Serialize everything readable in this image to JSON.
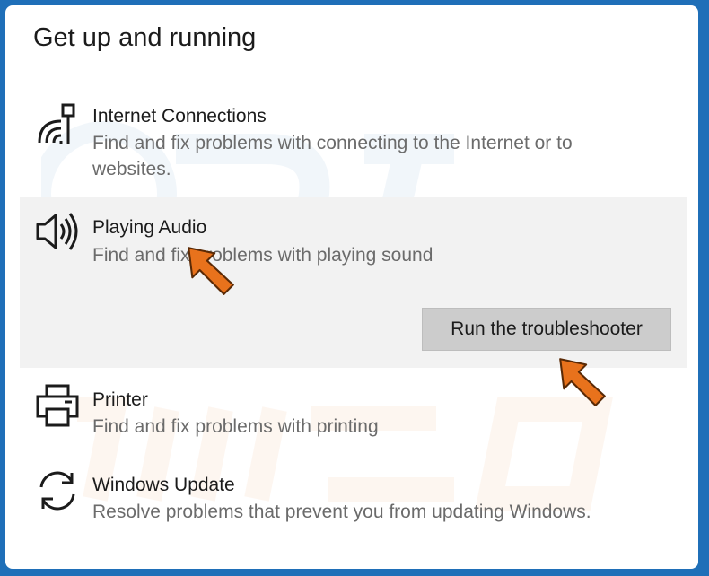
{
  "section_title": "Get up and running",
  "items": [
    {
      "name": "Internet Connections",
      "description": "Find and fix problems with connecting to the Internet or to websites.",
      "icon": "wifi-signal-icon"
    },
    {
      "name": "Playing Audio",
      "description": "Find and fix problems with playing sound",
      "icon": "speaker-icon",
      "selected": true
    },
    {
      "name": "Printer",
      "description": "Find and fix problems with printing",
      "icon": "printer-icon"
    },
    {
      "name": "Windows Update",
      "description": "Resolve problems that prevent you from updating Windows.",
      "icon": "refresh-icon"
    }
  ],
  "run_button_label": "Run the troubleshooter",
  "colors": {
    "border": "#1f6fb8",
    "selected_bg": "#f2f2f2",
    "button_bg": "#cccccc",
    "annotation_arrow": "#e8721c"
  }
}
